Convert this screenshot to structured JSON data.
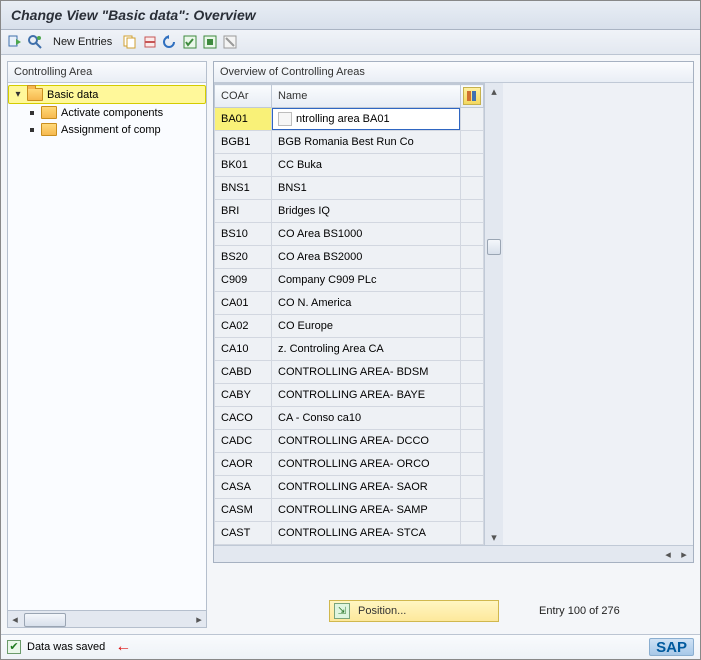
{
  "title": "Change View \"Basic data\": Overview",
  "toolbar": {
    "new_entries": "New Entries"
  },
  "tree": {
    "header": "Controlling Area",
    "root": "Basic data",
    "children": [
      "Activate components",
      "Assignment of comp"
    ]
  },
  "grid": {
    "title": "Overview of Controlling Areas",
    "cols": {
      "coar": "COAr",
      "name": "Name"
    },
    "rows": [
      {
        "co": "BA01",
        "name": "ntrolling area BA01",
        "selected": true
      },
      {
        "co": "BGB1",
        "name": "BGB Romania Best Run Co"
      },
      {
        "co": "BK01",
        "name": "CC Buka"
      },
      {
        "co": "BNS1",
        "name": "BNS1"
      },
      {
        "co": "BRI",
        "name": "Bridges IQ"
      },
      {
        "co": "BS10",
        "name": "CO Area BS1000"
      },
      {
        "co": "BS20",
        "name": "CO Area BS2000"
      },
      {
        "co": "C909",
        "name": "Company C909 PLc"
      },
      {
        "co": "CA01",
        "name": "CO N. America"
      },
      {
        "co": "CA02",
        "name": "CO Europe"
      },
      {
        "co": "CA10",
        "name": "z. Controling Area CA"
      },
      {
        "co": "CABD",
        "name": "CONTROLLING AREA- BDSM"
      },
      {
        "co": "CABY",
        "name": "CONTROLLING AREA- BAYE"
      },
      {
        "co": "CACO",
        "name": "CA - Conso ca10"
      },
      {
        "co": "CADC",
        "name": "CONTROLLING AREA- DCCO"
      },
      {
        "co": "CAOR",
        "name": "CONTROLLING AREA- ORCO"
      },
      {
        "co": "CASA",
        "name": "CONTROLLING AREA- SAOR"
      },
      {
        "co": "CASM",
        "name": "CONTROLLING AREA- SAMP"
      },
      {
        "co": "CAST",
        "name": "CONTROLLING AREA- STCA"
      }
    ]
  },
  "position": {
    "label": "Position...",
    "entry_text": "Entry 100 of 276"
  },
  "status": {
    "message": "Data was saved",
    "logo": "SAP"
  }
}
